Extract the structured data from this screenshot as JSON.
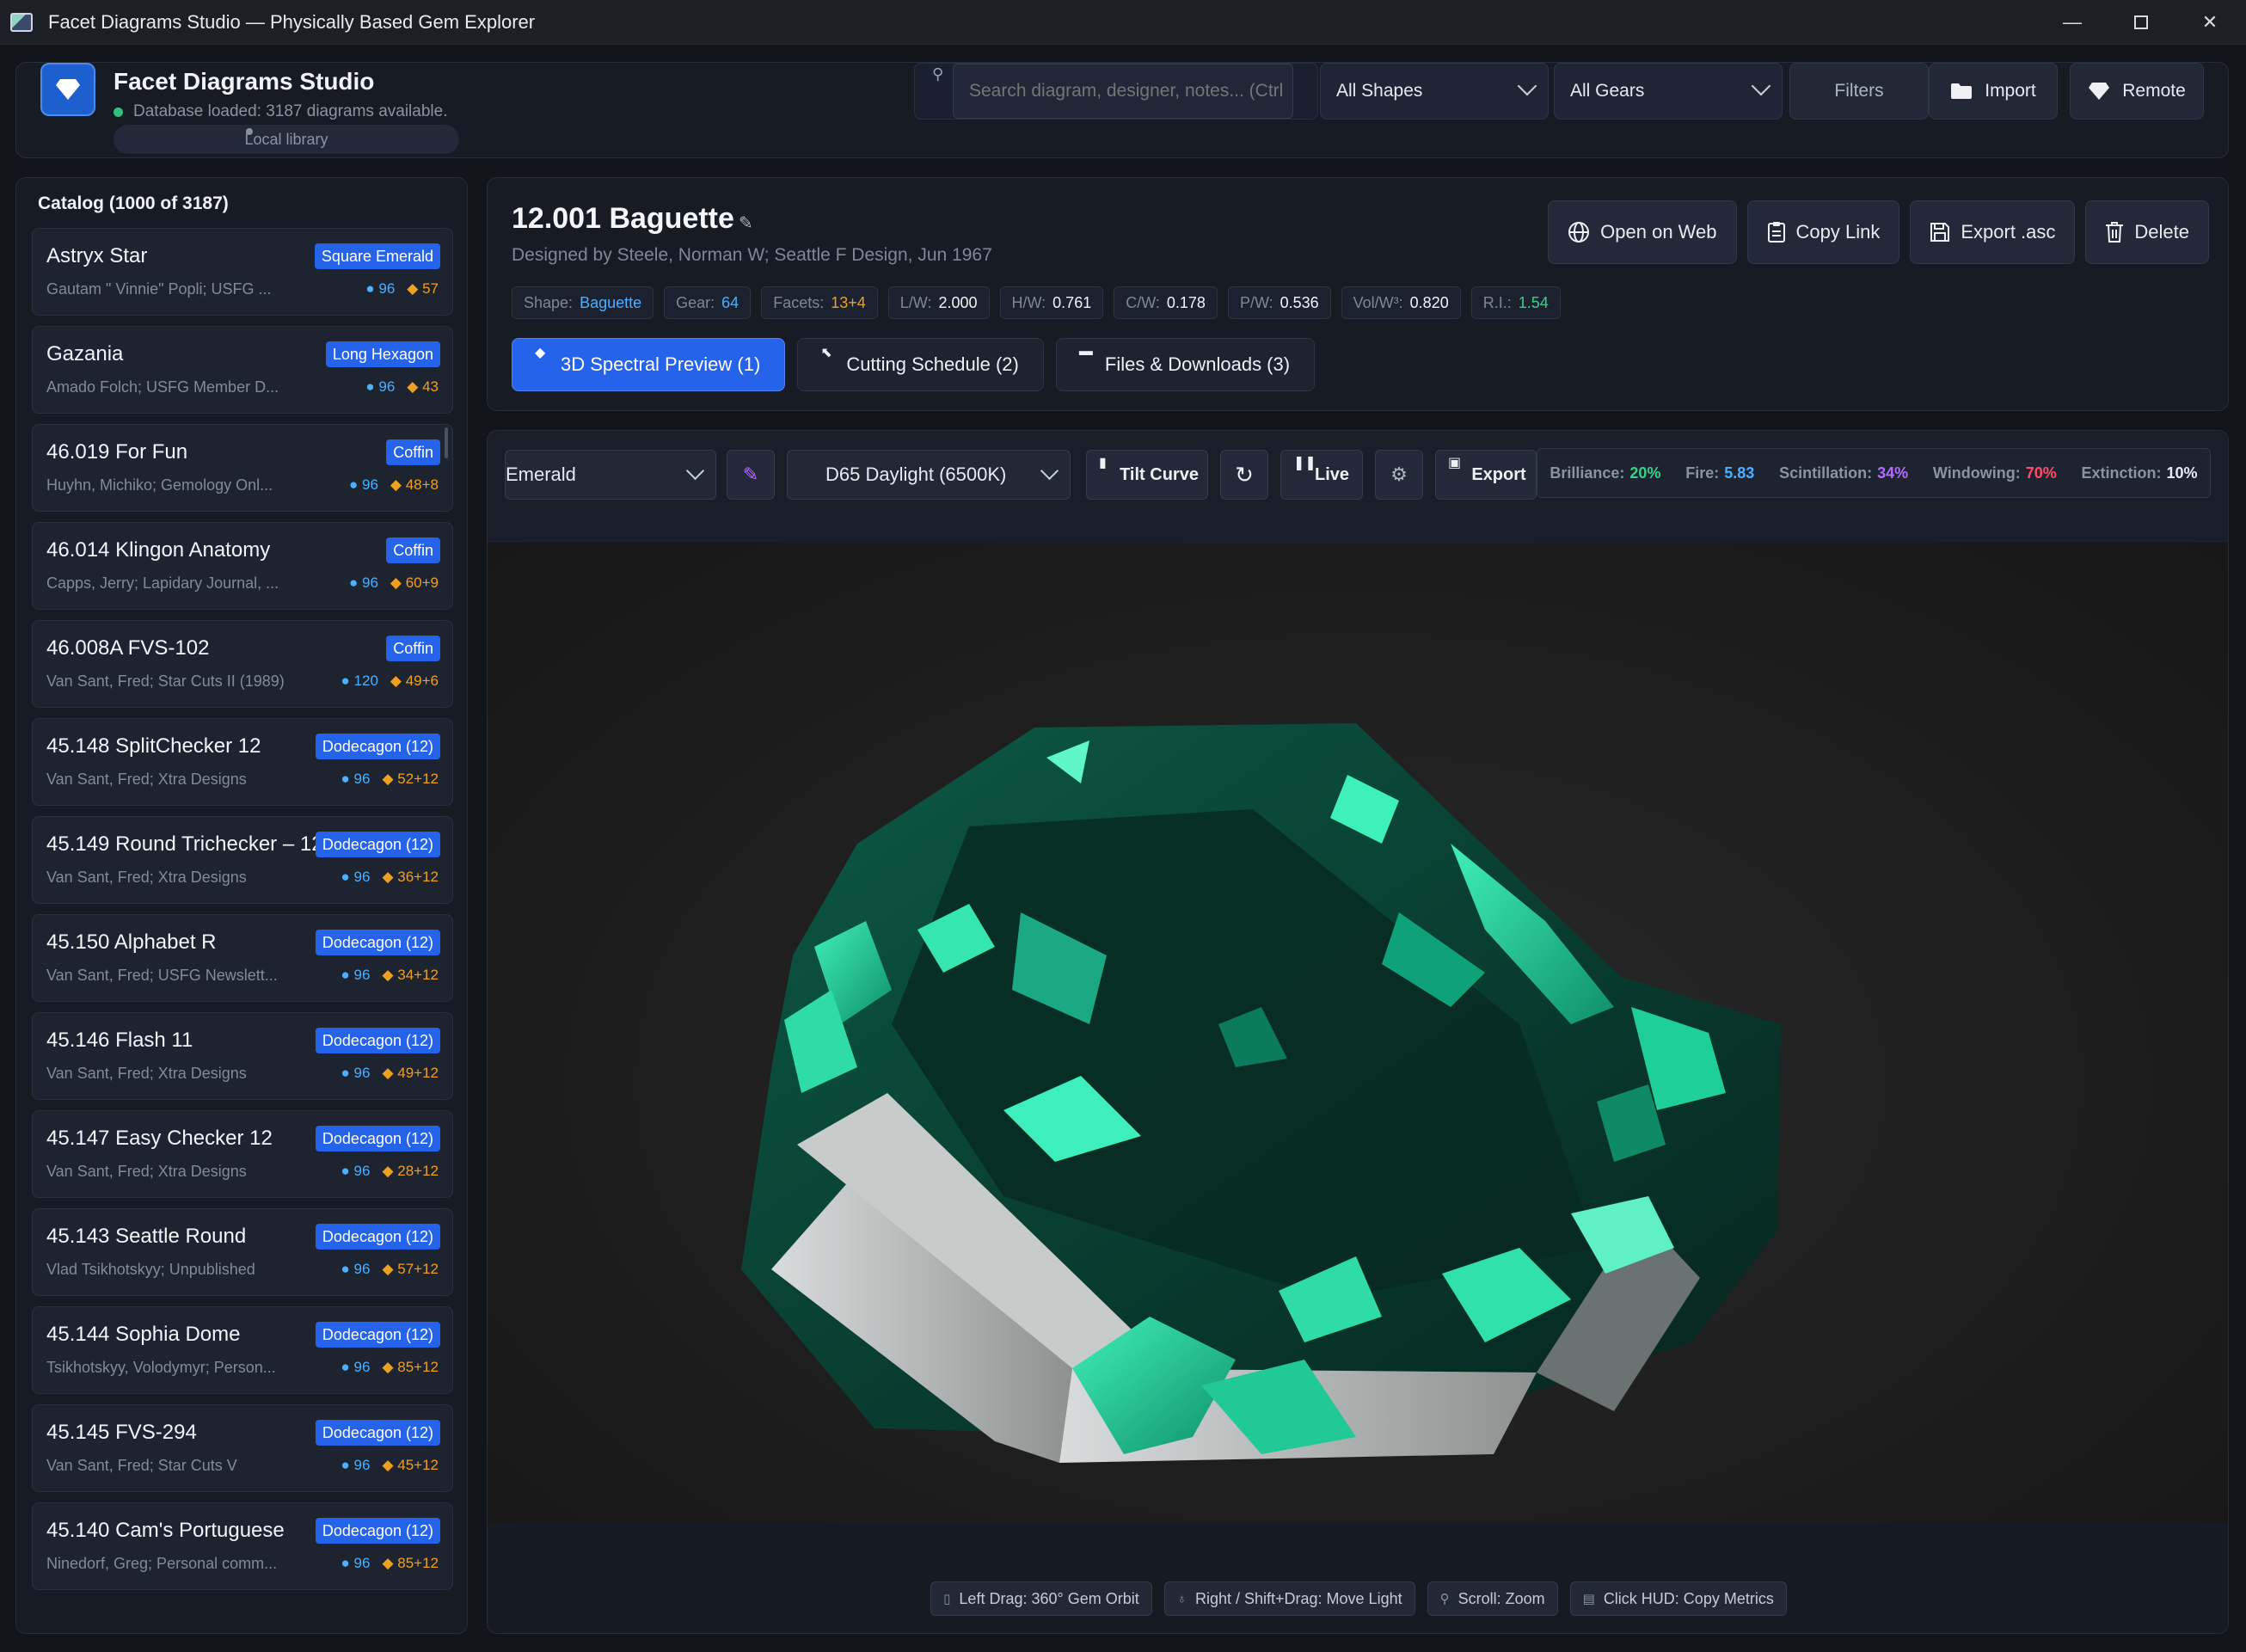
{
  "window": {
    "title": "Facet Diagrams Studio — Physically Based Gem Explorer",
    "minimize": "—",
    "maximize": "",
    "close": "✕"
  },
  "header": {
    "app_name": "Facet Diagrams Studio",
    "db_status": "Database loaded: 3187 diagrams available.",
    "library": "Local library",
    "search_placeholder": "Search diagram, designer, notes... (Ctrl",
    "shape_filter": "All Shapes",
    "gear_filter": "All Gears",
    "filters": "Filters",
    "import": "Import",
    "remote": "Remote"
  },
  "catalog": {
    "title": "Catalog (1000 of 3187)",
    "items": [
      {
        "name": "Astryx Star",
        "designer": "Gautam \" Vinnie\" Popli; USFG ...",
        "shape": "Square Emerald",
        "gear": "96",
        "facets": "57"
      },
      {
        "name": "Gazania",
        "designer": "Amado Folch; USFG Member D...",
        "shape": "Long Hexagon",
        "gear": "96",
        "facets": "43"
      },
      {
        "name": "46.019 For Fun",
        "designer": "Huyhn, Michiko; Gemology Onl...",
        "shape": "Coffin",
        "gear": "96",
        "facets": "48+8"
      },
      {
        "name": "46.014 Klingon Anatomy",
        "designer": "Capps, Jerry; Lapidary Journal, ...",
        "shape": "Coffin",
        "gear": "96",
        "facets": "60+9"
      },
      {
        "name": "46.008A FVS-102",
        "designer": "Van Sant, Fred; Star Cuts II (1989)",
        "shape": "Coffin",
        "gear": "120",
        "facets": "49+6"
      },
      {
        "name": "45.148 SplitChecker 12",
        "designer": "Van Sant, Fred; Xtra Designs",
        "shape": "Dodecagon (12)",
        "gear": "96",
        "facets": "52+12"
      },
      {
        "name": "45.149 Round Trichecker – 12",
        "designer": "Van Sant, Fred; Xtra Designs",
        "shape": "Dodecagon (12)",
        "gear": "96",
        "facets": "36+12"
      },
      {
        "name": "45.150 Alphabet R",
        "designer": "Van Sant, Fred; USFG Newslett...",
        "shape": "Dodecagon (12)",
        "gear": "96",
        "facets": "34+12"
      },
      {
        "name": "45.146 Flash 11",
        "designer": "Van Sant, Fred; Xtra Designs",
        "shape": "Dodecagon (12)",
        "gear": "96",
        "facets": "49+12"
      },
      {
        "name": "45.147 Easy Checker 12",
        "designer": "Van Sant, Fred; Xtra Designs",
        "shape": "Dodecagon (12)",
        "gear": "96",
        "facets": "28+12"
      },
      {
        "name": "45.143 Seattle Round",
        "designer": "Vlad Tsikhotskyy; Unpublished",
        "shape": "Dodecagon (12)",
        "gear": "96",
        "facets": "57+12"
      },
      {
        "name": "45.144 Sophia Dome",
        "designer": "Tsikhotskyy, Volodymyr; Person...",
        "shape": "Dodecagon (12)",
        "gear": "96",
        "facets": "85+12"
      },
      {
        "name": "45.145 FVS-294",
        "designer": "Van Sant, Fred; Star Cuts V",
        "shape": "Dodecagon (12)",
        "gear": "96",
        "facets": "45+12"
      },
      {
        "name": "45.140 Cam's Portuguese",
        "designer": "Ninedorf, Greg; Personal comm...",
        "shape": "Dodecagon (12)",
        "gear": "96",
        "facets": "85+12"
      }
    ]
  },
  "detail": {
    "title": "12.001 Baguette",
    "subtitle": "Designed by Steele, Norman W; Seattle F Design, Jun 1967",
    "actions": {
      "open_web": "Open on Web",
      "copy_link": "Copy Link",
      "export_asc": "Export .asc",
      "delete": "Delete"
    },
    "specs": {
      "shape_label": "Shape:",
      "shape": "Baguette",
      "gear_label": "Gear:",
      "gear": "64",
      "facets_label": "Facets:",
      "facets": "13+4",
      "lw_label": "L/W:",
      "lw": "2.000",
      "hw_label": "H/W:",
      "hw": "0.761",
      "cw_label": "C/W:",
      "cw": "0.178",
      "pw_label": "P/W:",
      "pw": "0.536",
      "vol_label": "Vol/W³:",
      "vol": "0.820",
      "ri_label": "R.I.:",
      "ri": "1.54"
    },
    "tabs": {
      "preview": "3D Spectral Preview (1)",
      "schedule": "Cutting Schedule (2)",
      "files": "Files & Downloads (3)"
    }
  },
  "viewer": {
    "material": "Emerald",
    "light": "D65 Daylight (6500K)",
    "tilt": "Tilt Curve",
    "live": "Live",
    "export": "Export",
    "metrics": {
      "brilliance_label": "Brilliance:",
      "brilliance": "20%",
      "fire_label": "Fire:",
      "fire": "5.83",
      "scint_label": "Scintillation:",
      "scint": "34%",
      "window_label": "Windowing:",
      "window": "70%",
      "ext_label": "Extinction:",
      "ext": "10%"
    },
    "hints": {
      "orbit": "Left Drag: 360° Gem Orbit",
      "light": "Right / Shift+Drag: Move Light",
      "zoom": "Scroll: Zoom",
      "copy": "Click HUD: Copy Metrics"
    }
  },
  "colors": {
    "accent": "#2563eb",
    "gear": "#4ab0ff",
    "facets": "#f0a020",
    "brilliance": "#3ad08a",
    "scintillation": "#b36cff",
    "windowing": "#ff4d6d",
    "gem": "#1fcf9a"
  }
}
